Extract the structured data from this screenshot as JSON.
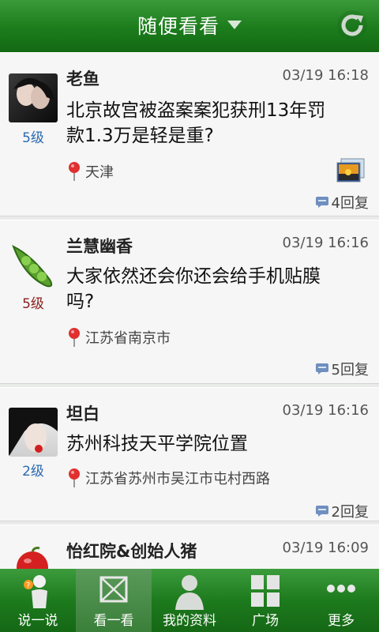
{
  "header": {
    "title": "随便看看"
  },
  "posts": [
    {
      "name": "老鱼",
      "time": "03/19 16:18",
      "level": "5级",
      "text_line1": "北京故宫被盗案案犯获刑13年罚",
      "text_line2": "款1.3万是轻是重?",
      "location": "天津",
      "replies": "4回复",
      "has_photo": true
    },
    {
      "name": "兰慧幽香",
      "time": "03/19 16:16",
      "level": "5级",
      "text_line1": "大家依然还会你还会给手机贴膜",
      "text_line2": "吗?",
      "location": "江苏省南京市",
      "replies": "5回复"
    },
    {
      "name": "坦白",
      "time": "03/19 16:16",
      "level": "2级",
      "text_line1": "苏州科技天平学院位置",
      "location": "江苏省苏州市吴江市屯村西路",
      "replies": "2回复"
    },
    {
      "name": "怡红院&创始人猪",
      "time": "03/19 16:09"
    }
  ],
  "tabs": [
    {
      "label": "说一说",
      "icon": "person-speak-icon"
    },
    {
      "label": "看一看",
      "icon": "envelope-icon"
    },
    {
      "label": "我的资料",
      "icon": "profile-icon"
    },
    {
      "label": "广场",
      "icon": "grid-icon"
    },
    {
      "label": "更多",
      "icon": "more-icon"
    }
  ],
  "colors": {
    "header_green": "#1c7c1c",
    "level_blue": "#2a6ab0",
    "level_red": "#8a2020"
  }
}
